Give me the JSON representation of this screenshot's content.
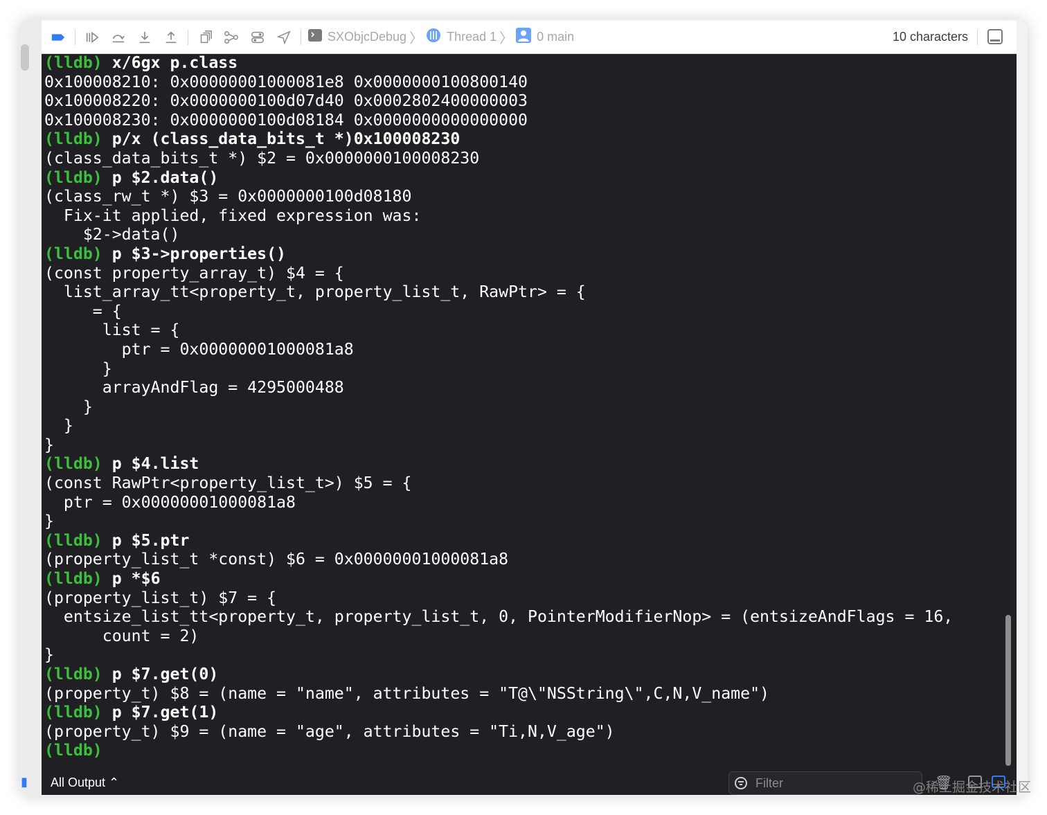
{
  "toolbar": {
    "scheme": "SXObjcDebug",
    "thread": "Thread 1",
    "frame": "0 main",
    "char_count": "10 characters",
    "icons": [
      "breakpoint-icon",
      "continue-icon",
      "step-over-icon",
      "step-in-icon",
      "step-out-icon",
      "view-hierarchy-icon",
      "memory-graph-icon",
      "environment-icon",
      "location-icon"
    ]
  },
  "console": {
    "lines": [
      {
        "prompt": "(lldb)",
        "cmd": " x/6gx p.class"
      },
      {
        "text": "0x100008210: 0x00000001000081e8 0x0000000100800140"
      },
      {
        "text": "0x100008220: 0x0000000100d07d40 0x0002802400000003"
      },
      {
        "text": "0x100008230: 0x0000000100d08184 0x0000000000000000"
      },
      {
        "prompt": "(lldb)",
        "cmd": " p/x (class_data_bits_t *)0x100008230"
      },
      {
        "text": "(class_data_bits_t *) $2 = 0x0000000100008230"
      },
      {
        "prompt": "(lldb)",
        "cmd": " p $2.data()"
      },
      {
        "text": "(class_rw_t *) $3 = 0x0000000100d08180"
      },
      {
        "text": "  Fix-it applied, fixed expression was:"
      },
      {
        "text": "    $2->data()"
      },
      {
        "prompt": "(lldb)",
        "cmd": " p $3->properties()"
      },
      {
        "text": "(const property_array_t) $4 = {"
      },
      {
        "text": "  list_array_tt<property_t, property_list_t, RawPtr> = {"
      },
      {
        "text": "     = {"
      },
      {
        "text": "      list = {"
      },
      {
        "text": "        ptr = 0x00000001000081a8"
      },
      {
        "text": "      }"
      },
      {
        "text": "      arrayAndFlag = 4295000488"
      },
      {
        "text": "    }"
      },
      {
        "text": "  }"
      },
      {
        "text": "}"
      },
      {
        "prompt": "(lldb)",
        "cmd": " p $4.list"
      },
      {
        "text": "(const RawPtr<property_list_t>) $5 = {"
      },
      {
        "text": "  ptr = 0x00000001000081a8"
      },
      {
        "text": "}"
      },
      {
        "prompt": "(lldb)",
        "cmd": " p $5.ptr"
      },
      {
        "text": "(property_list_t *const) $6 = 0x00000001000081a8"
      },
      {
        "prompt": "(lldb)",
        "cmd": " p *$6"
      },
      {
        "text": "(property_list_t) $7 = {"
      },
      {
        "text": "  entsize_list_tt<property_t, property_list_t, 0, PointerModifierNop> = (entsizeAndFlags = 16,"
      },
      {
        "text": "      count = 2)"
      },
      {
        "text": "}"
      },
      {
        "prompt": "(lldb)",
        "cmd": " p $7.get(0)"
      },
      {
        "text": "(property_t) $8 = (name = \"name\", attributes = \"T@\\\"NSString\\\",C,N,V_name\")"
      },
      {
        "prompt": "(lldb)",
        "cmd": " p $7.get(1)"
      },
      {
        "text": "(property_t) $9 = (name = \"age\", attributes = \"Ti,N,V_age\")"
      },
      {
        "prompt": "(lldb)",
        "cmd": ""
      }
    ]
  },
  "bottom": {
    "output_selector": "All Output ⌃",
    "filter_placeholder": "Filter"
  },
  "watermark": "@稀土掘金技术社区",
  "colors": {
    "prompt": "#3cc03c",
    "console_bg": "#1f1f24",
    "accent": "#2f7cf6"
  }
}
